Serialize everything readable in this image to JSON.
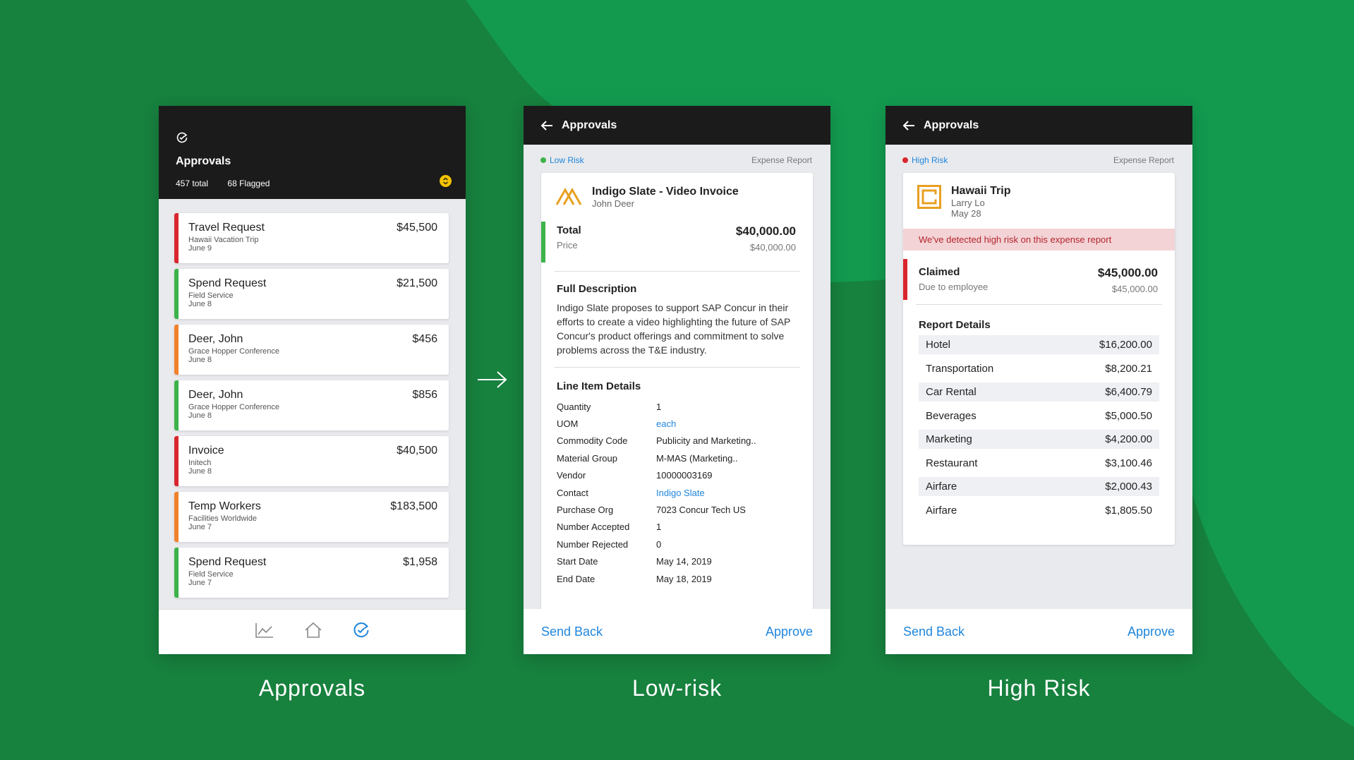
{
  "colors": {
    "bg_green": "#16833f",
    "accent_blue": "#1f86dc",
    "flag_red": "#d9262e",
    "flag_green": "#3db34a",
    "flag_orange": "#f0822d",
    "warning_bg": "#f3d3d5"
  },
  "approvals": {
    "header_icon": "refresh-check-icon",
    "title": "Approvals",
    "total": "457 total",
    "flagged": "68 Flagged",
    "items": [
      {
        "title": "Travel Request",
        "sub": "Hawaii Vacation Trip",
        "date": "June 9",
        "amount": "$45,500",
        "status": "red"
      },
      {
        "title": "Spend Request",
        "sub": "Field Service",
        "date": "June 8",
        "amount": "$21,500",
        "status": "green"
      },
      {
        "title": "Deer, John",
        "sub": "Grace Hopper Conference",
        "date": "June 8",
        "amount": "$456",
        "status": "orange"
      },
      {
        "title": "Deer, John",
        "sub": "Grace Hopper Conference",
        "date": "June 8",
        "amount": "$856",
        "status": "green"
      },
      {
        "title": "Invoice",
        "sub": "Initech",
        "date": "June 8",
        "amount": "$40,500",
        "status": "red"
      },
      {
        "title": "Temp Workers",
        "sub": "Facilities Worldwide",
        "date": "June 7",
        "amount": "$183,500",
        "status": "orange"
      },
      {
        "title": "Spend Request",
        "sub": "Field Service",
        "date": "June 7",
        "amount": "$1,958",
        "status": "green"
      }
    ],
    "tabbar": [
      "chart-icon",
      "home-icon",
      "refresh-check-icon"
    ],
    "caption": "Approvals"
  },
  "low_risk": {
    "header_title": "Approvals",
    "risk_label": "Low Risk",
    "report_type": "Expense Report",
    "vendor_name": "Indigo Slate - Video Invoice",
    "vendor_contact": "John Deer",
    "total_label": "Total",
    "total_sub": "Price",
    "total_amount": "$40,000.00",
    "total_amount_sub": "$40,000.00",
    "description_title": "Full Description",
    "description": "Indigo Slate proposes to support SAP Concur in their efforts to create a video highlighting the future of SAP Concur's product offerings and commitment to solve problems across the T&E industry.",
    "line_items_title": "Line Item Details",
    "line_items": [
      {
        "label": "Quantity",
        "value": "1",
        "link": false
      },
      {
        "label": "UOM",
        "value": "each",
        "link": true
      },
      {
        "label": "Commodity Code",
        "value": "Publicity and Marketing..",
        "link": false
      },
      {
        "label": "Material Group",
        "value": "M-MAS (Marketing..",
        "link": false
      },
      {
        "label": "Vendor",
        "value": "10000003169",
        "link": false
      },
      {
        "label": "Contact",
        "value": "Indigo Slate",
        "link": true
      },
      {
        "label": "Purchase Org",
        "value": "7023 Concur Tech US",
        "link": false
      },
      {
        "label": "Number Accepted",
        "value": "1",
        "link": false
      },
      {
        "label": "Number Rejected",
        "value": "0",
        "link": false
      },
      {
        "label": "Start Date",
        "value": "May 14, 2019",
        "link": false
      },
      {
        "label": "End Date",
        "value": "May 18, 2019",
        "link": false
      }
    ],
    "send_back": "Send Back",
    "approve": "Approve",
    "caption": "Low-risk"
  },
  "high_risk": {
    "header_title": "Approvals",
    "risk_label": "High Risk",
    "report_type": "Expense Report",
    "trip_name": "Hawaii Trip",
    "employee": "Larry Lo",
    "date": "May 28",
    "warning": "We've detected high risk on this expense report",
    "claimed_label": "Claimed",
    "claimed_sub": "Due to employee",
    "claimed_amount": "$45,000.00",
    "claimed_amount_sub": "$45,000.00",
    "report_details_title": "Report Details",
    "details": [
      {
        "label": "Hotel",
        "value": "$16,200.00"
      },
      {
        "label": "Transportation",
        "value": "$8,200.21"
      },
      {
        "label": "Car Rental",
        "value": "$6,400.79"
      },
      {
        "label": "Beverages",
        "value": "$5,000.50"
      },
      {
        "label": "Marketing",
        "value": "$4,200.00"
      },
      {
        "label": "Restaurant",
        "value": "$3,100.46"
      },
      {
        "label": "Airfare",
        "value": "$2,000.43"
      },
      {
        "label": "Airfare",
        "value": "$1,805.50"
      }
    ],
    "send_back": "Send Back",
    "approve": "Approve",
    "caption": "High Risk"
  }
}
